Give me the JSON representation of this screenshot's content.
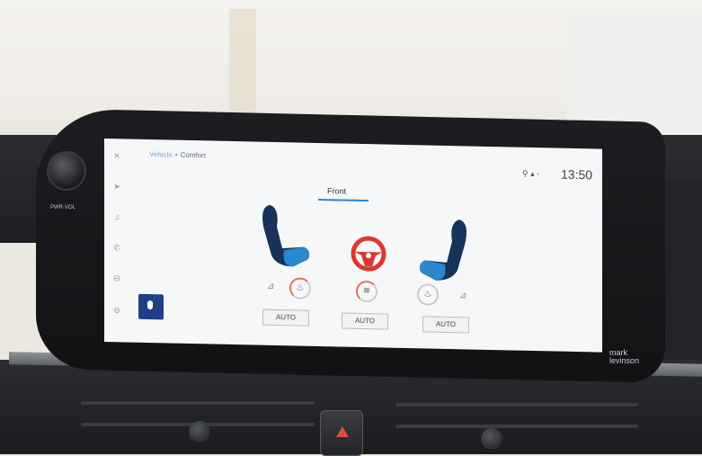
{
  "screen": {
    "breadcrumb": {
      "parent": "Vehicle",
      "current": "Comfort"
    },
    "status": {
      "icons": "⚲ ▴ ◦"
    },
    "clock": "13:50",
    "tab": {
      "label": "Front"
    },
    "auto_buttons": {
      "left": "AUTO",
      "center": "AUTO",
      "right": "AUTO"
    },
    "icons": {
      "sidebar": [
        "close-icon",
        "navigation-icon",
        "music-icon",
        "phone-icon",
        "car-icon",
        "settings-icon"
      ],
      "mic": "microphone-icon",
      "seats": [
        "seat-left-icon",
        "steering-wheel-icon",
        "seat-right-icon"
      ]
    }
  },
  "hardware": {
    "knob_label": "PWR·VOL",
    "brand": "mark levinson"
  },
  "colors": {
    "accent": "#2b83d4",
    "mic_button": "#1f3f86",
    "heat_active": "#e07060",
    "seat_blue": "#1c5ea8",
    "wheel_red": "#d93a2f"
  }
}
